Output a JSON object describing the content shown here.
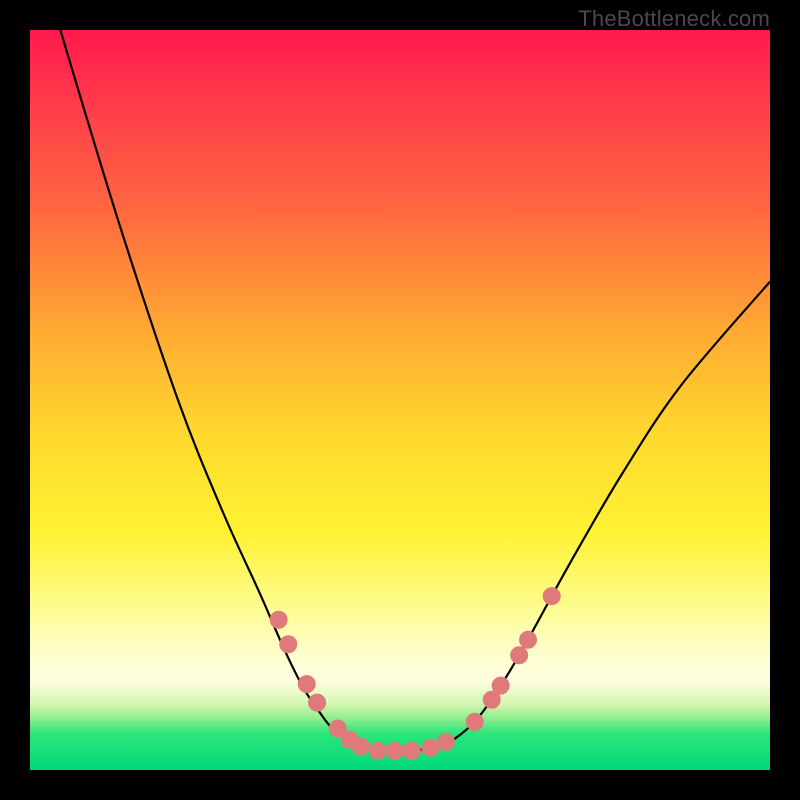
{
  "watermark": "TheBottleneck.com",
  "chart_data": {
    "type": "line",
    "title": "",
    "xlabel": "",
    "ylabel": "",
    "xlim": [
      0,
      100
    ],
    "ylim": [
      0,
      100
    ],
    "curve": [
      {
        "x": 4.1,
        "y": 100
      },
      {
        "x": 12,
        "y": 74
      },
      {
        "x": 20,
        "y": 50
      },
      {
        "x": 26,
        "y": 35
      },
      {
        "x": 31,
        "y": 24
      },
      {
        "x": 34.5,
        "y": 16
      },
      {
        "x": 37,
        "y": 11
      },
      {
        "x": 39,
        "y": 8
      },
      {
        "x": 41,
        "y": 5.5
      },
      {
        "x": 44.5,
        "y": 3.2
      },
      {
        "x": 48,
        "y": 2.6
      },
      {
        "x": 51.5,
        "y": 2.6
      },
      {
        "x": 55,
        "y": 3.2
      },
      {
        "x": 57.5,
        "y": 4.3
      },
      {
        "x": 60.5,
        "y": 7
      },
      {
        "x": 64,
        "y": 12
      },
      {
        "x": 67.5,
        "y": 18
      },
      {
        "x": 73,
        "y": 28
      },
      {
        "x": 80,
        "y": 40
      },
      {
        "x": 88,
        "y": 52
      },
      {
        "x": 100,
        "y": 66
      }
    ],
    "points": [
      {
        "x": 33.6,
        "y": 20.3
      },
      {
        "x": 34.9,
        "y": 17.0
      },
      {
        "x": 37.4,
        "y": 11.6
      },
      {
        "x": 38.8,
        "y": 9.1
      },
      {
        "x": 41.6,
        "y": 5.6
      },
      {
        "x": 43.2,
        "y": 4.1
      },
      {
        "x": 44.7,
        "y": 3.2
      },
      {
        "x": 47.0,
        "y": 2.6
      },
      {
        "x": 49.3,
        "y": 2.6
      },
      {
        "x": 51.6,
        "y": 2.6
      },
      {
        "x": 54.1,
        "y": 3.0
      },
      {
        "x": 56.2,
        "y": 3.8
      },
      {
        "x": 60.1,
        "y": 6.5
      },
      {
        "x": 62.4,
        "y": 9.5
      },
      {
        "x": 63.6,
        "y": 11.4
      },
      {
        "x": 66.1,
        "y": 15.5
      },
      {
        "x": 67.3,
        "y": 17.6
      },
      {
        "x": 70.5,
        "y": 23.5
      }
    ],
    "background_gradient": [
      {
        "stop": 0.0,
        "color": "#ff1a4d"
      },
      {
        "stop": 0.1,
        "color": "#ff3b4a"
      },
      {
        "stop": 0.25,
        "color": "#ff6a3f"
      },
      {
        "stop": 0.4,
        "color": "#ffa733"
      },
      {
        "stop": 0.55,
        "color": "#ffd92e"
      },
      {
        "stop": 0.68,
        "color": "#fff233"
      },
      {
        "stop": 0.78,
        "color": "#fdfc8f"
      },
      {
        "stop": 0.84,
        "color": "#fefecb"
      },
      {
        "stop": 0.88,
        "color": "#fdfde0"
      },
      {
        "stop": 0.91,
        "color": "#d6f7b0"
      },
      {
        "stop": 0.93,
        "color": "#90ee90"
      },
      {
        "stop": 0.95,
        "color": "#2ee67a"
      },
      {
        "stop": 1.0,
        "color": "#00d97a"
      }
    ]
  }
}
